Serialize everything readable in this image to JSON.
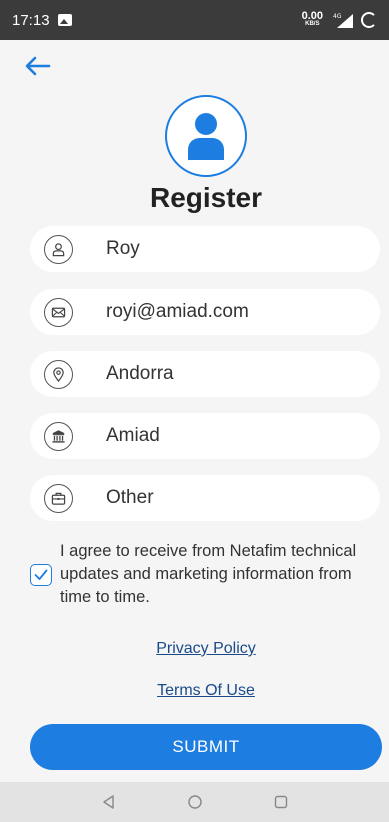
{
  "status_bar": {
    "time": "17:13",
    "speed_value": "0.00",
    "speed_unit": "KB/S",
    "network": "4G"
  },
  "page": {
    "title": "Register"
  },
  "fields": [
    {
      "name": "name",
      "value": "Roy",
      "icon": "person-icon"
    },
    {
      "name": "email",
      "value": "royi@amiad.com",
      "icon": "envelope-icon"
    },
    {
      "name": "country",
      "value": "Andorra",
      "icon": "location-pin-icon"
    },
    {
      "name": "company",
      "value": "Amiad",
      "icon": "building-icon"
    },
    {
      "name": "role",
      "value": "Other",
      "icon": "briefcase-icon"
    }
  ],
  "consent": {
    "checked": true,
    "text": "I agree to receive from Netafim technical updates and marketing information from time to time."
  },
  "links": {
    "privacy": "Privacy Policy",
    "terms": "Terms Of Use"
  },
  "submit": {
    "label": "SUBMIT"
  },
  "colors": {
    "accent": "#1d7de0",
    "link": "#1a4a8a",
    "background": "#f5f5f5"
  }
}
